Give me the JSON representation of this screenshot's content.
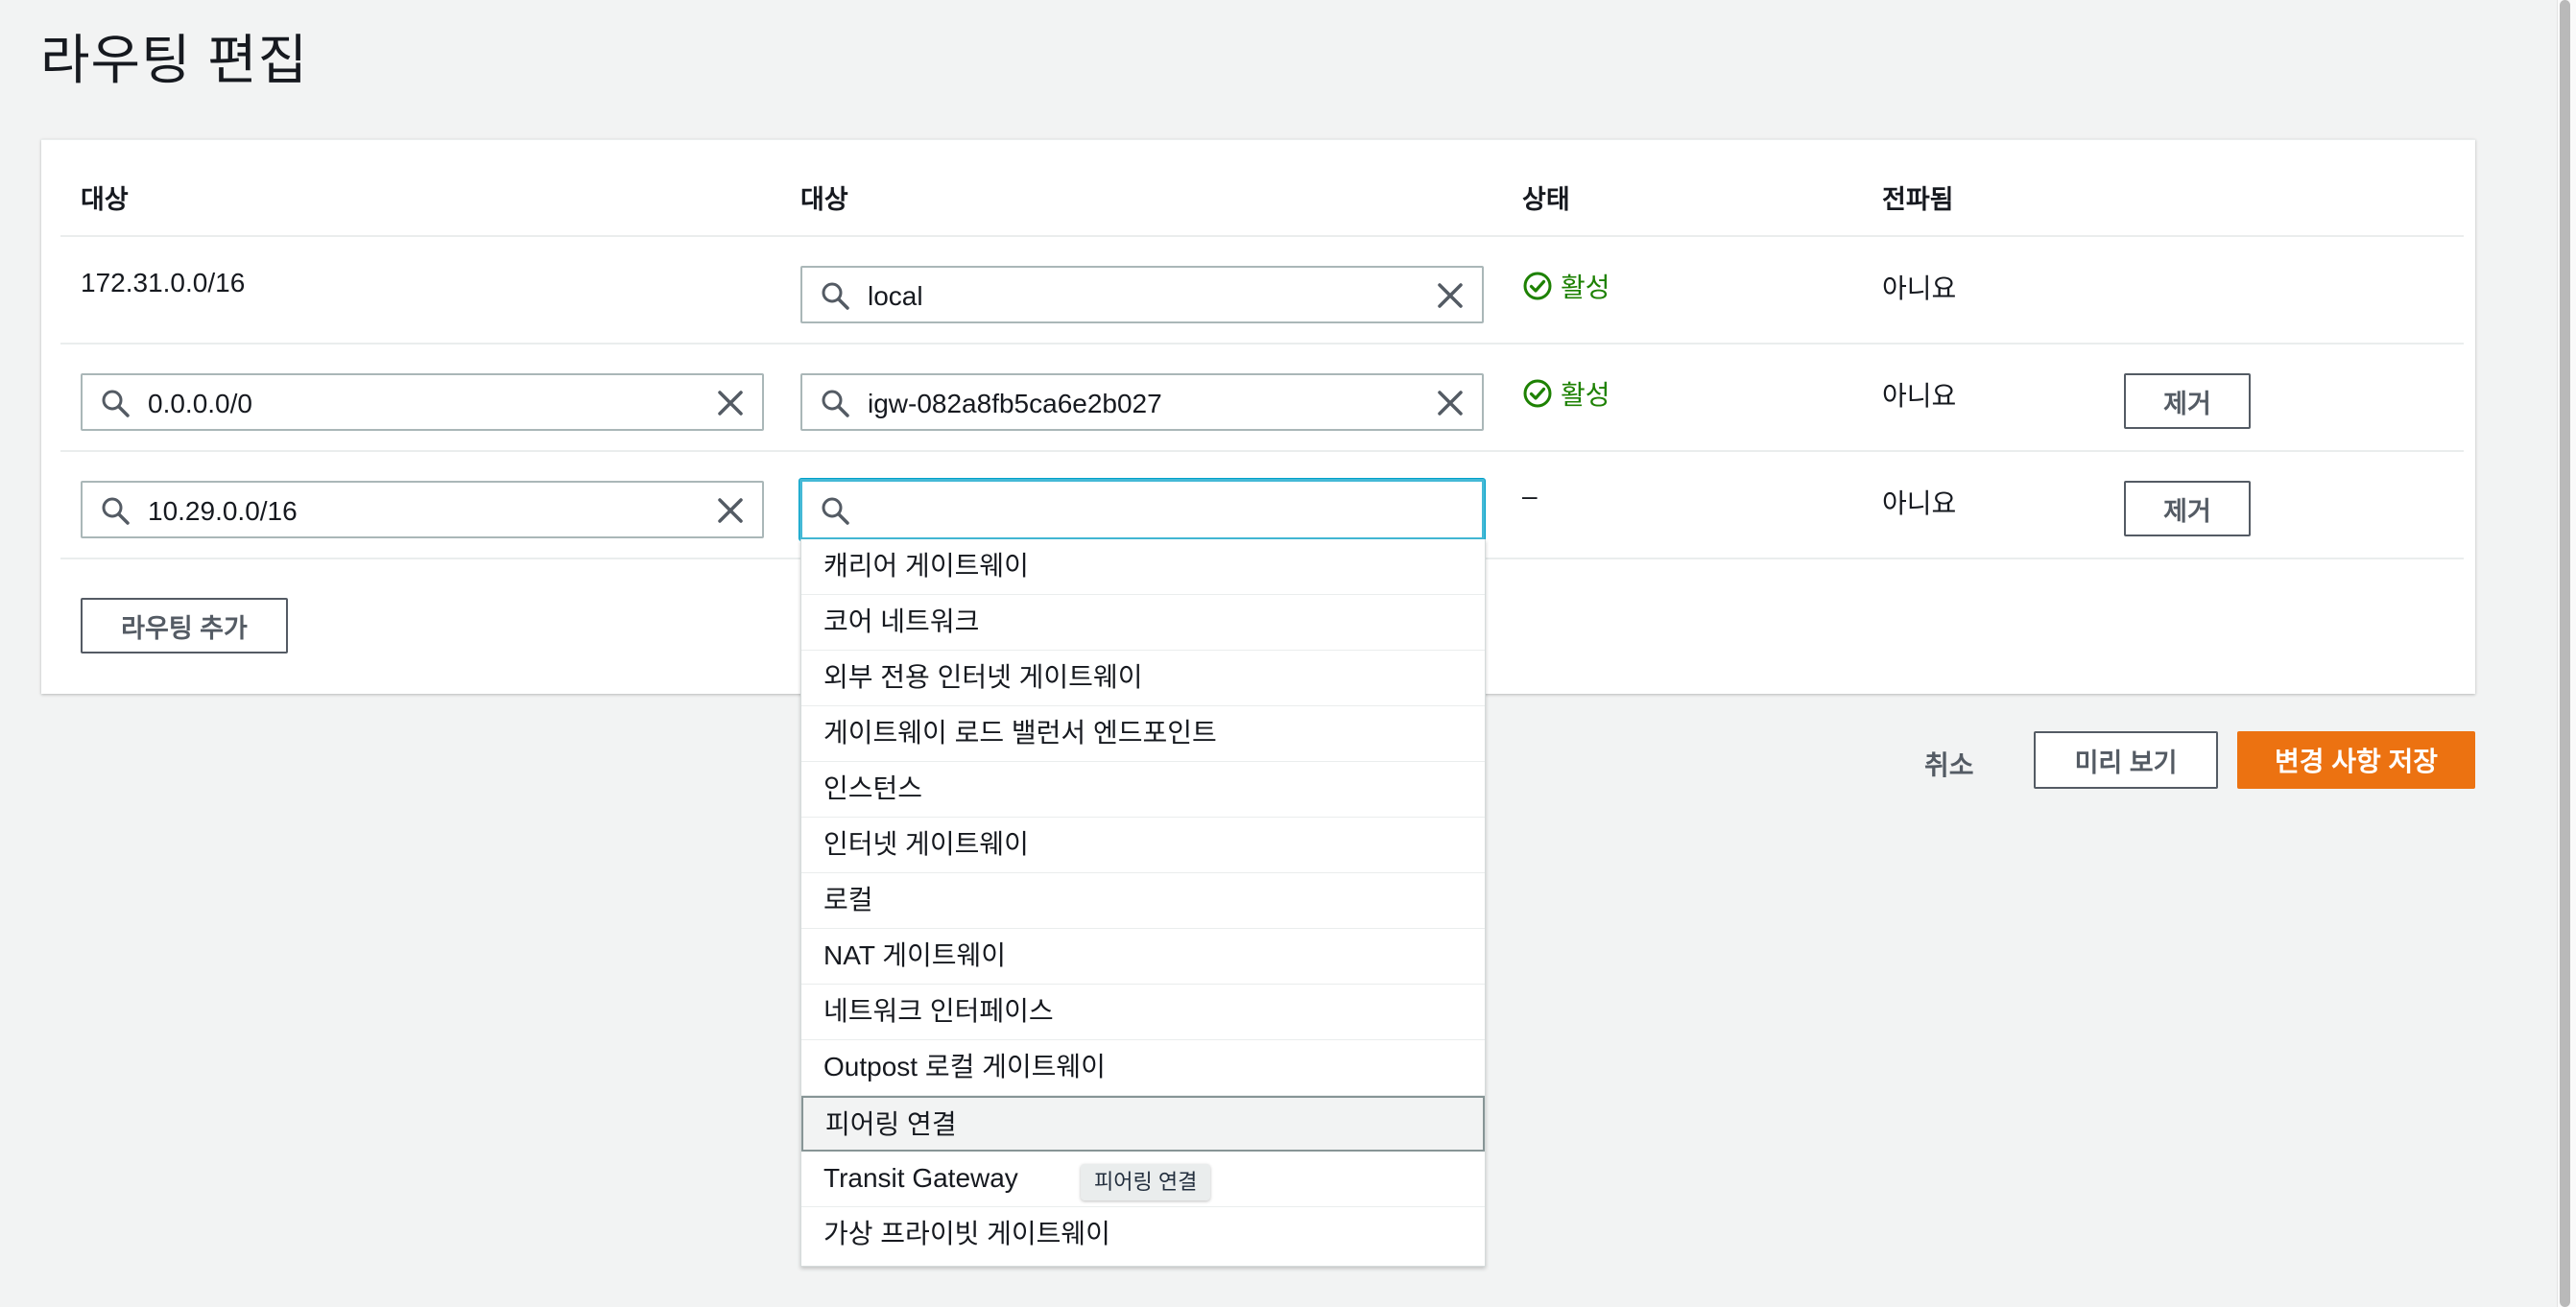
{
  "page": {
    "title": "라우팅 편집"
  },
  "table": {
    "headers": {
      "destination": "대상",
      "target": "대상",
      "status": "상태",
      "propagated": "전파됨"
    },
    "rows": [
      {
        "destination": "172.31.0.0/16",
        "target": "local",
        "status": "활성",
        "propagated": "아니요"
      },
      {
        "destination": "0.0.0.0/0",
        "target": "igw-082a8fb5ca6e2b027",
        "status": "활성",
        "propagated": "아니요",
        "remove_label": "제거"
      },
      {
        "destination": "10.29.0.0/16",
        "target": "",
        "status": "–",
        "propagated": "아니요",
        "remove_label": "제거"
      }
    ],
    "add_route_label": "라우팅 추가"
  },
  "dropdown": {
    "options": [
      "캐리어 게이트웨이",
      "코어 네트워크",
      "외부 전용 인터넷 게이트웨이",
      "게이트웨이 로드 밸런서 엔드포인트",
      "인스턴스",
      "인터넷 게이트웨이",
      "로컬",
      "NAT 게이트웨이",
      "네트워크 인터페이스",
      "Outpost 로컬 게이트웨이",
      "피어링 연결",
      "Transit Gateway",
      "가상 프라이빗 게이트웨이"
    ],
    "highlighted": "피어링 연결",
    "tooltip": "피어링 연결"
  },
  "footer": {
    "cancel_label": "취소",
    "preview_label": "미리 보기",
    "save_label": "변경 사항 저장"
  },
  "colors": {
    "accent": "#ec7211",
    "active": "#1d8102",
    "focus": "#44b9d6"
  },
  "icons": {
    "search": "search-icon",
    "clear": "close-icon",
    "status": "check-circle-icon"
  }
}
